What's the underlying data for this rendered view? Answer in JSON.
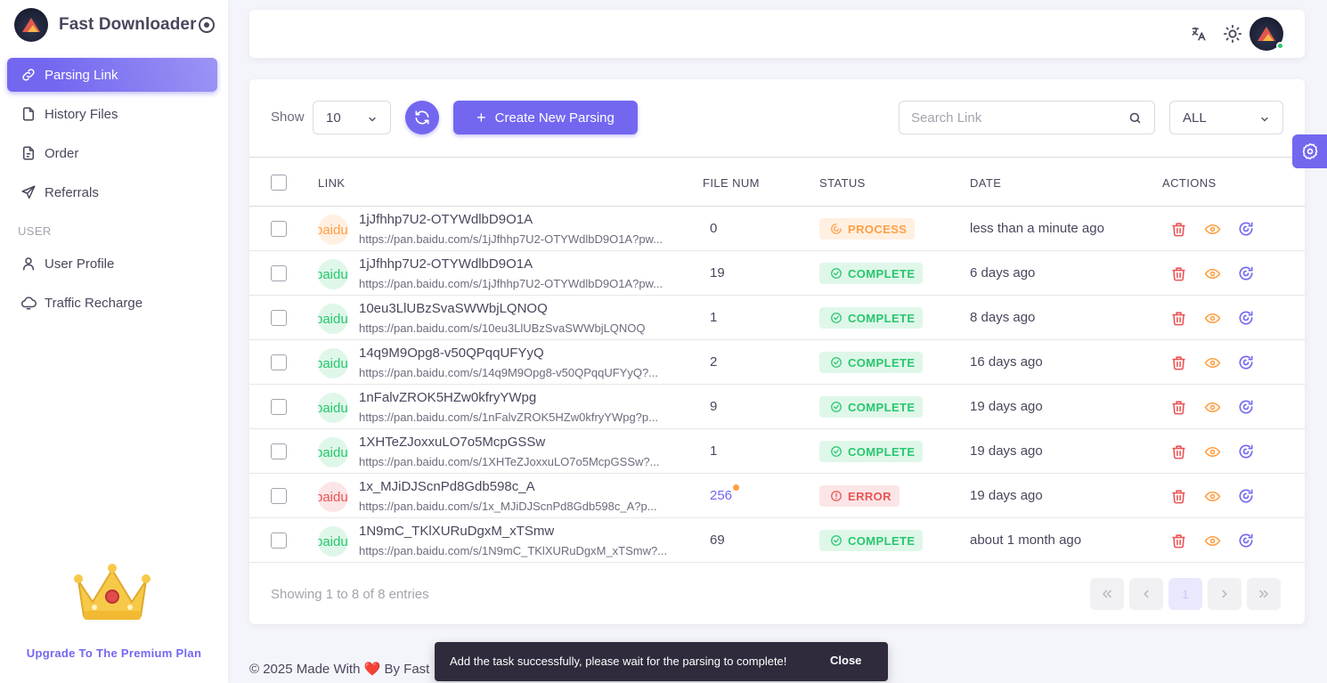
{
  "app": {
    "name": "Fast Downloader",
    "upgrade_label": "Upgrade To The Premium Plan"
  },
  "sidebar": {
    "items": [
      {
        "label": "Parsing Link",
        "icon": "link-icon",
        "active": true
      },
      {
        "label": "History Files",
        "icon": "file-icon"
      },
      {
        "label": "Order",
        "icon": "file-text-icon"
      },
      {
        "label": "Referrals",
        "icon": "send-icon"
      }
    ],
    "section_user": "USER",
    "user_items": [
      {
        "label": "User Profile",
        "icon": "user-icon"
      },
      {
        "label": "Traffic Recharge",
        "icon": "cloud-icon"
      }
    ]
  },
  "toolbar": {
    "show_label": "Show",
    "page_size": "10",
    "create_label": "Create New Parsing",
    "search_placeholder": "Search Link",
    "filter_value": "ALL"
  },
  "table": {
    "headers": [
      "LINK",
      "FILE NUM",
      "STATUS",
      "DATE",
      "ACTIONS"
    ],
    "avatar_text": "baidu",
    "rows": [
      {
        "title": "1jJfhhp7U2-OTYWdlbD9O1A",
        "url": "https://pan.baidu.com/s/1jJfhhp7U2-OTYWdlbD9O1A?pw...",
        "file_num": "0",
        "status": "PROCESS",
        "date": "less than a minute ago"
      },
      {
        "title": "1jJfhhp7U2-OTYWdlbD9O1A",
        "url": "https://pan.baidu.com/s/1jJfhhp7U2-OTYWdlbD9O1A?pw...",
        "file_num": "19",
        "status": "COMPLETE",
        "date": "6 days ago"
      },
      {
        "title": "10eu3LlUBzSvaSWWbjLQNOQ",
        "url": "https://pan.baidu.com/s/10eu3LlUBzSvaSWWbjLQNOQ",
        "file_num": "1",
        "status": "COMPLETE",
        "date": "8 days ago"
      },
      {
        "title": "14q9M9Opg8-v50QPqqUFYyQ",
        "url": "https://pan.baidu.com/s/14q9M9Opg8-v50QPqqUFYyQ?...",
        "file_num": "2",
        "status": "COMPLETE",
        "date": "16 days ago"
      },
      {
        "title": "1nFalvZROK5HZw0kfryYWpg",
        "url": "https://pan.baidu.com/s/1nFalvZROK5HZw0kfryYWpg?p...",
        "file_num": "9",
        "status": "COMPLETE",
        "date": "19 days ago"
      },
      {
        "title": "1XHTeZJoxxuLO7o5McpGSSw",
        "url": "https://pan.baidu.com/s/1XHTeZJoxxuLO7o5McpGSSw?...",
        "file_num": "1",
        "status": "COMPLETE",
        "date": "19 days ago"
      },
      {
        "title": "1x_MJiDJScnPd8Gdb598c_A",
        "url": "https://pan.baidu.com/s/1x_MJiDJScnPd8Gdb598c_A?p...",
        "file_num": "256",
        "status": "ERROR",
        "date": "19 days ago"
      },
      {
        "title": "1N9mC_TKlXURuDgxM_xTSmw",
        "url": "https://pan.baidu.com/s/1N9mC_TKlXURuDgxM_xTSmw?...",
        "file_num": "69",
        "status": "COMPLETE",
        "date": "about 1 month ago"
      }
    ]
  },
  "pagination": {
    "summary": "Showing 1 to 8 of 8 entries",
    "current_page": "1"
  },
  "footer": {
    "prefix": "© 2025 Made With",
    "suffix": "By Fast"
  },
  "toast": {
    "message": "Add the task successfully, please wait for the parsing to complete!",
    "close_label": "Close"
  },
  "colors": {
    "primary": "#7367f0",
    "success": "#28c76f",
    "warning": "#ff9f43",
    "danger": "#ea5455"
  }
}
